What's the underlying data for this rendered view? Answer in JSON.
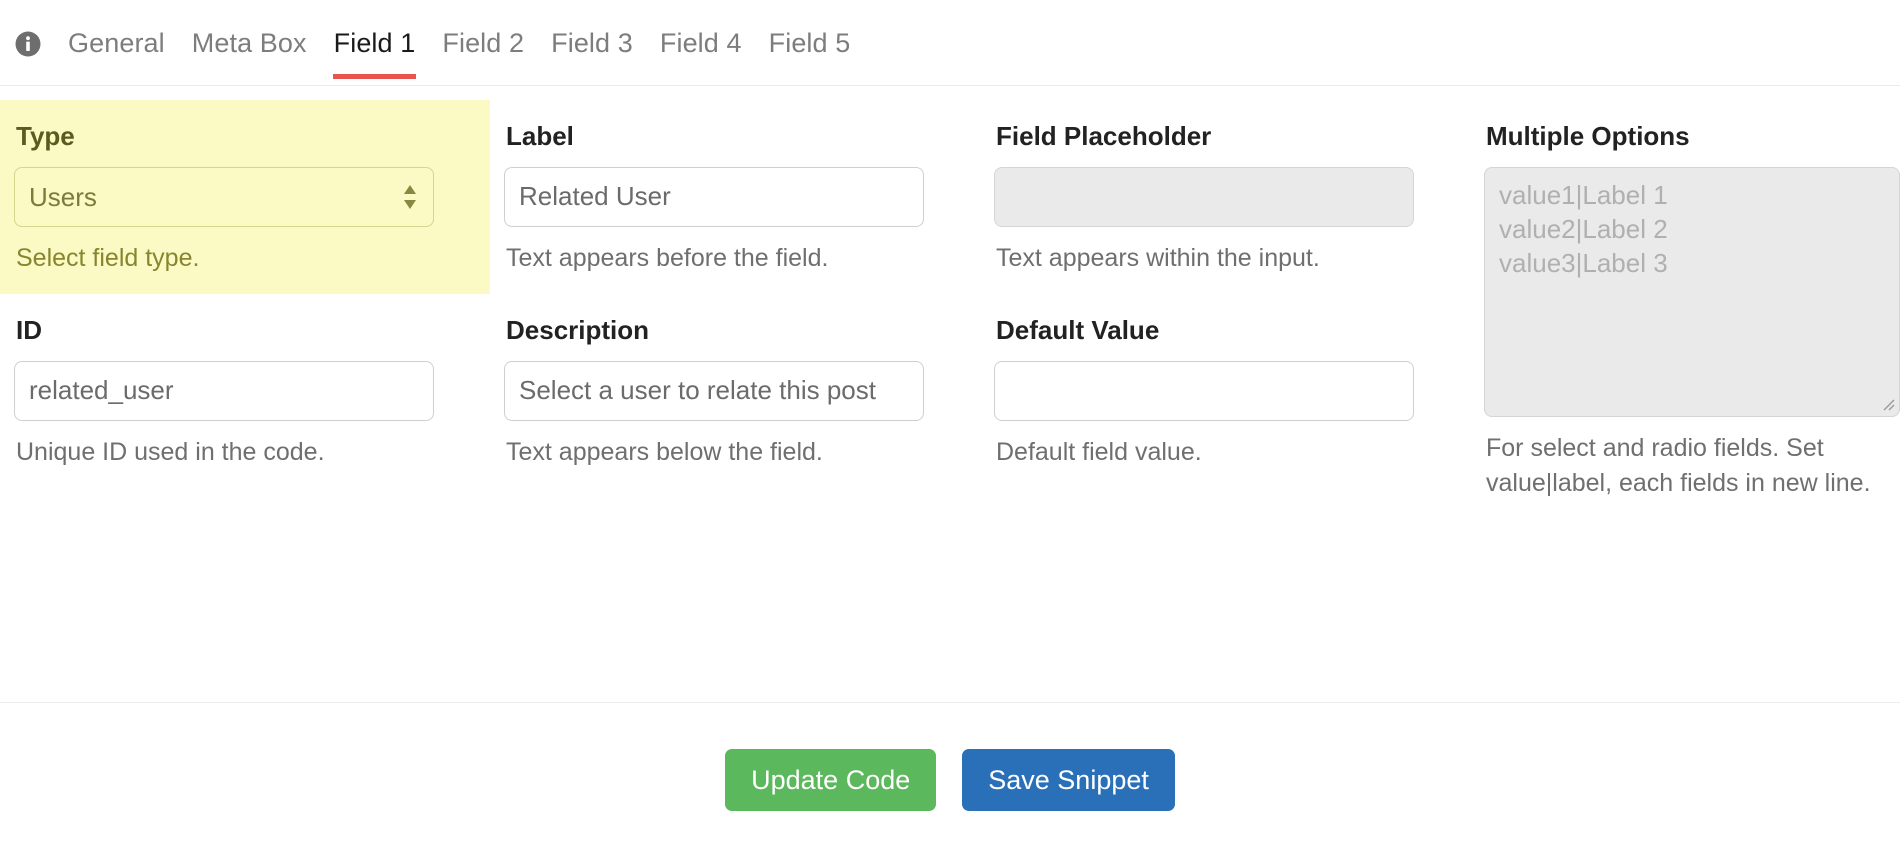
{
  "tabs": {
    "info_icon": "info-icon",
    "items": [
      {
        "label": "General",
        "active": false
      },
      {
        "label": "Meta Box",
        "active": false
      },
      {
        "label": "Field 1",
        "active": true
      },
      {
        "label": "Field 2",
        "active": false
      },
      {
        "label": "Field 3",
        "active": false
      },
      {
        "label": "Field 4",
        "active": false
      },
      {
        "label": "Field 5",
        "active": false
      }
    ],
    "active_underline_color": "#e8544f"
  },
  "fields": {
    "type": {
      "label": "Type",
      "value": "Users",
      "help": "Select field type.",
      "highlighted": true,
      "highlight_color": "#fbf9c4",
      "options": [
        "Users"
      ]
    },
    "id": {
      "label": "ID",
      "value": "related_user",
      "placeholder": "",
      "help": "Unique ID used in the code."
    },
    "field_label": {
      "label": "Label",
      "value": "Related User",
      "placeholder": "",
      "help": "Text appears before the field."
    },
    "description": {
      "label": "Description",
      "value": "Select a user to relate this post",
      "placeholder": "",
      "help": "Text appears below the field."
    },
    "field_placeholder": {
      "label": "Field Placeholder",
      "value": "",
      "placeholder": "",
      "help": "Text appears within the input.",
      "disabled": true
    },
    "default_value": {
      "label": "Default Value",
      "value": "",
      "placeholder": "",
      "help": "Default field value."
    },
    "multiple_options": {
      "label": "Multiple Options",
      "value": "",
      "placeholder": "value1|Label 1\nvalue2|Label 2\nvalue3|Label 3",
      "help": "For select and radio fields. Set value|label, each fields in new line.",
      "disabled": true
    }
  },
  "actions": {
    "update_label": "Update Code",
    "save_label": "Save Snippet",
    "update_color": "#5cb85c",
    "save_color": "#2a70b8"
  }
}
